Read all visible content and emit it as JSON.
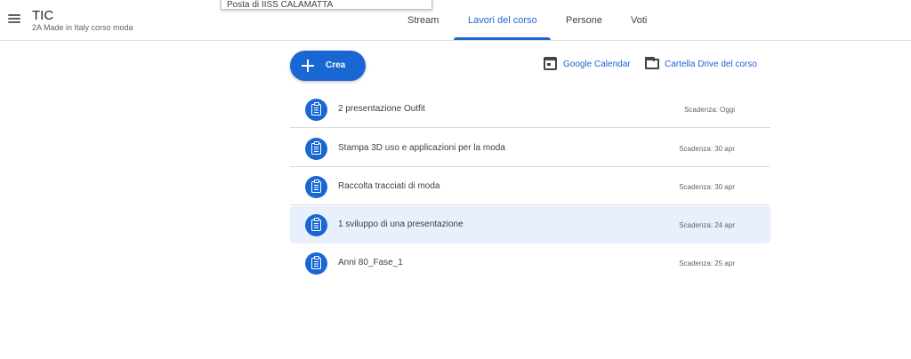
{
  "header": {
    "class_title": "TIC",
    "class_subtitle": "2A Made in Italy corso moda",
    "menu_icon": "hamburger-menu-icon"
  },
  "dropdown_snippet": "Posta di IISS CALAMATTA",
  "tabs": [
    {
      "label": "Stream",
      "active": false
    },
    {
      "label": "Lavori del corso",
      "active": true
    },
    {
      "label": "Persone",
      "active": false
    },
    {
      "label": "Voti",
      "active": false
    }
  ],
  "toolbar": {
    "create_label": "Crea",
    "calendar_label": "Google Calendar",
    "drive_label": "Cartella Drive del corso"
  },
  "assignments": [
    {
      "title": "2 presentazione Outfit",
      "due": "Scadenza: Oggi",
      "highlighted": false
    },
    {
      "title": "Stampa 3D uso e applicazioni per la moda",
      "due": "Scadenza: 30 apr",
      "highlighted": false
    },
    {
      "title": "Raccolta tracciati di moda",
      "due": "Scadenza: 30 apr",
      "highlighted": false
    },
    {
      "title": "1 sviluppo di una presentazione",
      "due": "Scadenza: 24 apr",
      "highlighted": true
    },
    {
      "title": "Anni 80_Fase_1",
      "due": "Scadenza: 25 apr",
      "highlighted": false
    }
  ],
  "colors": {
    "accent": "#1967d2",
    "highlight_row": "#e8f0fe",
    "divider": "#dadce0"
  }
}
